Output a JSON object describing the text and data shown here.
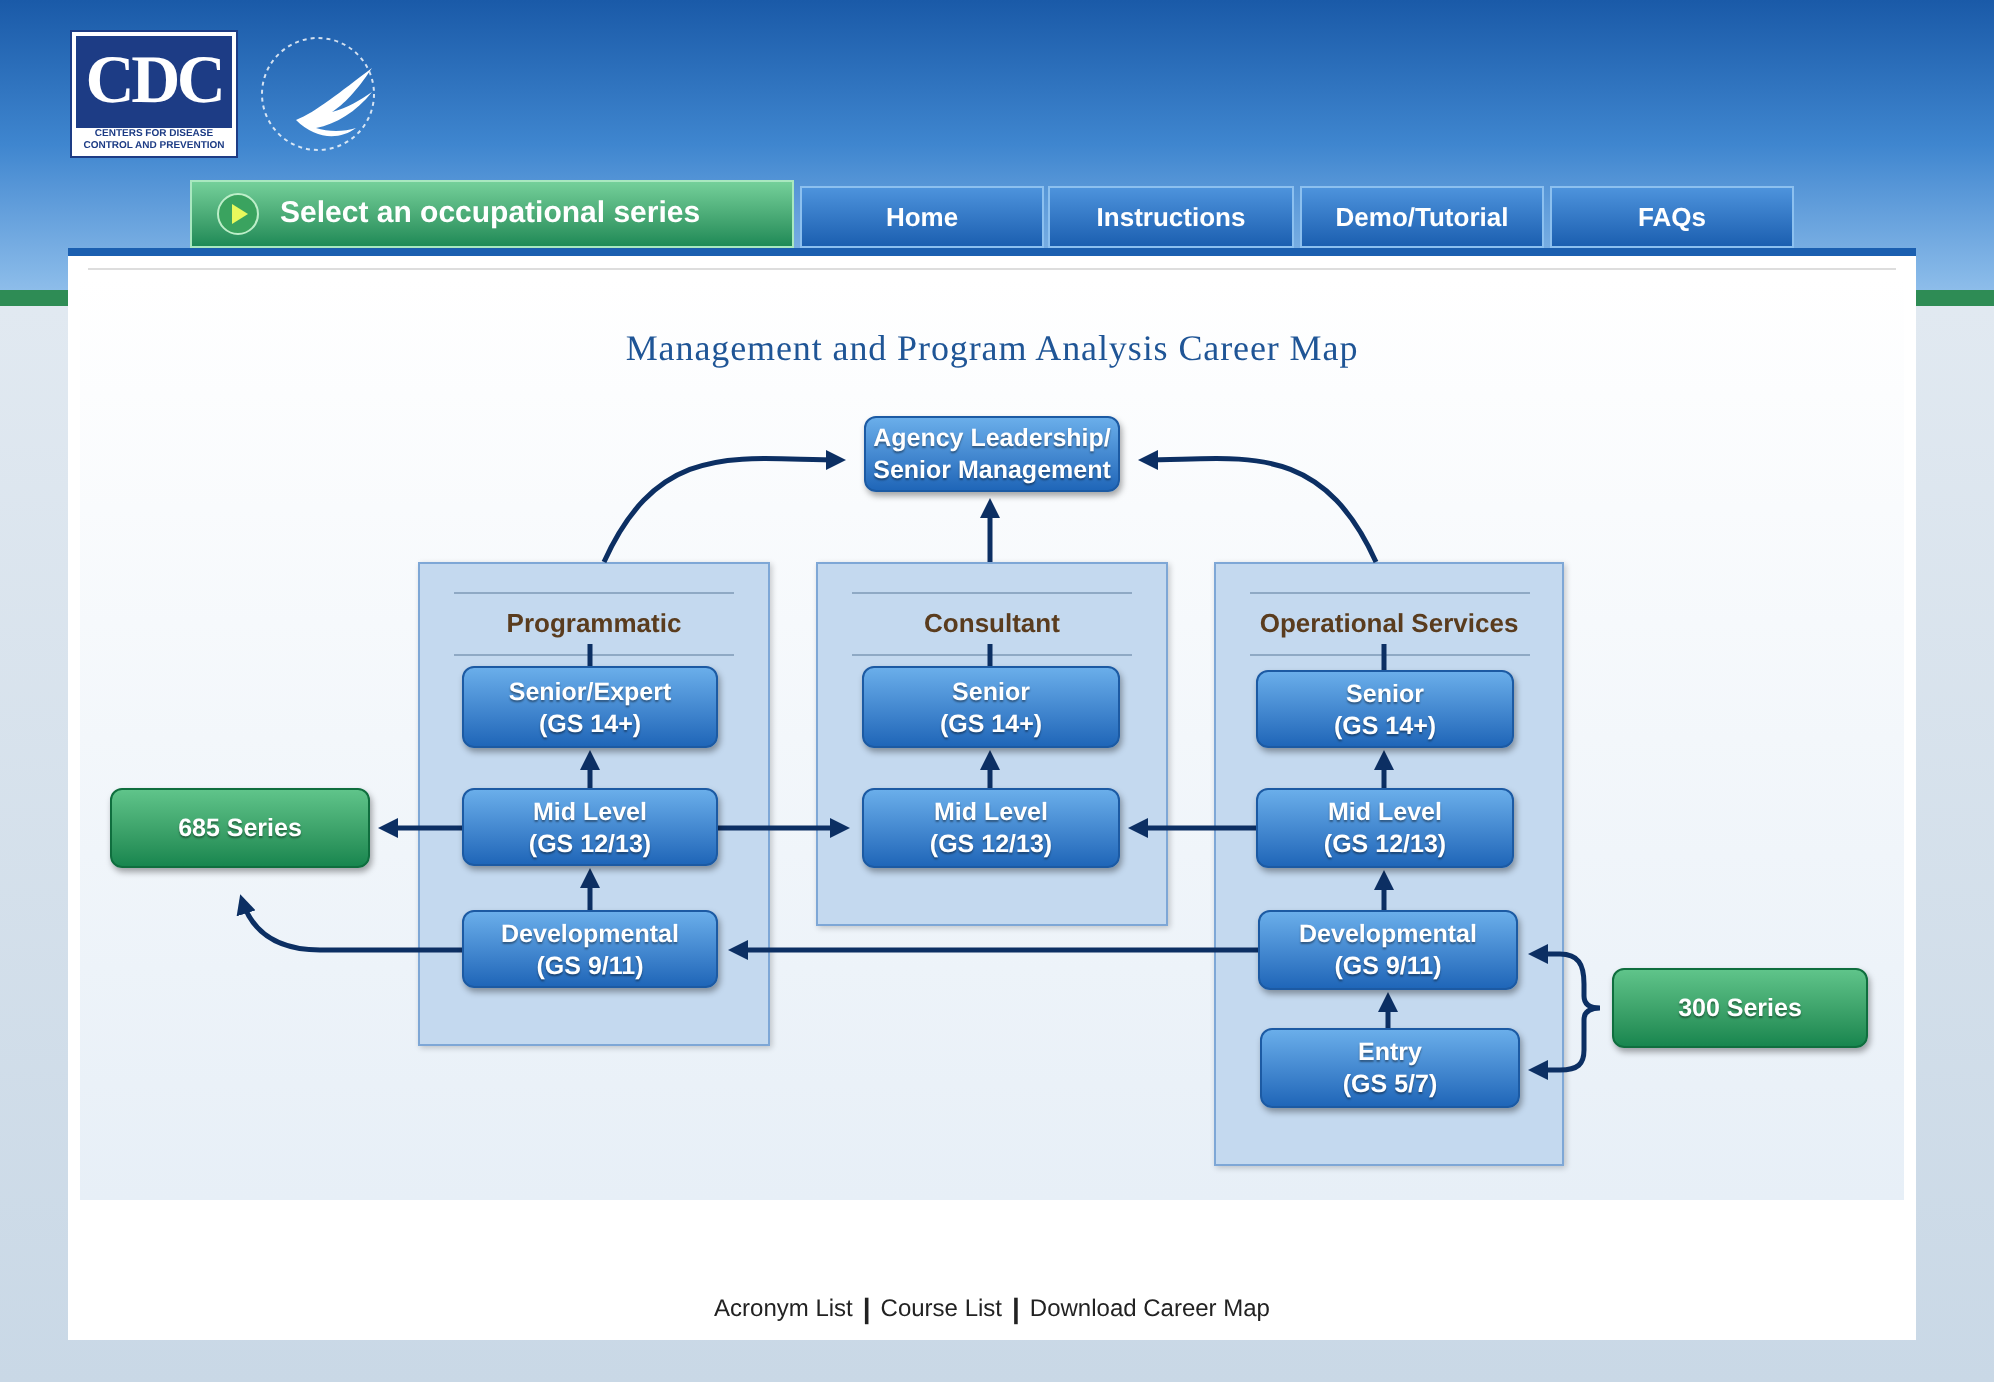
{
  "logo": {
    "wordmark": "CDC",
    "caption_lines": [
      "CENTERS FOR DISEASE",
      "CONTROL AND PREVENTION"
    ]
  },
  "nav": [
    {
      "label": "Select an occupational series",
      "kind": "primary",
      "selected": true
    },
    {
      "label": "Home",
      "kind": "tab",
      "selected": false
    },
    {
      "label": "Instructions",
      "kind": "tab",
      "selected": false
    },
    {
      "label": "Demo/Tutorial",
      "kind": "tab",
      "selected": false
    },
    {
      "label": "FAQs",
      "kind": "tab",
      "selected": false
    }
  ],
  "title": "Management and Program Analysis Career Map",
  "diagram": {
    "top": {
      "lines": [
        "Agency Leadership/",
        "Senior Management"
      ]
    },
    "columns": [
      {
        "heading": "Programmatic",
        "levels": [
          {
            "lines": [
              "Senior/Expert",
              "(GS 14+)"
            ]
          },
          {
            "lines": [
              "Mid Level",
              "(GS 12/13)"
            ]
          },
          {
            "lines": [
              "Developmental",
              "(GS 9/11)"
            ]
          }
        ]
      },
      {
        "heading": "Consultant",
        "levels": [
          {
            "lines": [
              "Senior",
              "(GS 14+)"
            ]
          },
          {
            "lines": [
              "Mid Level",
              "(GS 12/13)"
            ]
          }
        ]
      },
      {
        "heading": "Operational Services",
        "levels": [
          {
            "lines": [
              "Senior",
              "(GS 14+)"
            ]
          },
          {
            "lines": [
              "Mid Level",
              "(GS 12/13)"
            ]
          },
          {
            "lines": [
              "Developmental",
              "(GS 9/11)"
            ]
          },
          {
            "lines": [
              "Entry",
              "(GS 5/7)"
            ]
          }
        ]
      }
    ],
    "series": [
      {
        "label": "685 Series"
      },
      {
        "label": "300 Series"
      }
    ]
  },
  "footer": {
    "separator": "|",
    "links": [
      "Acronym List",
      "Course List",
      "Download Career Map"
    ]
  }
}
